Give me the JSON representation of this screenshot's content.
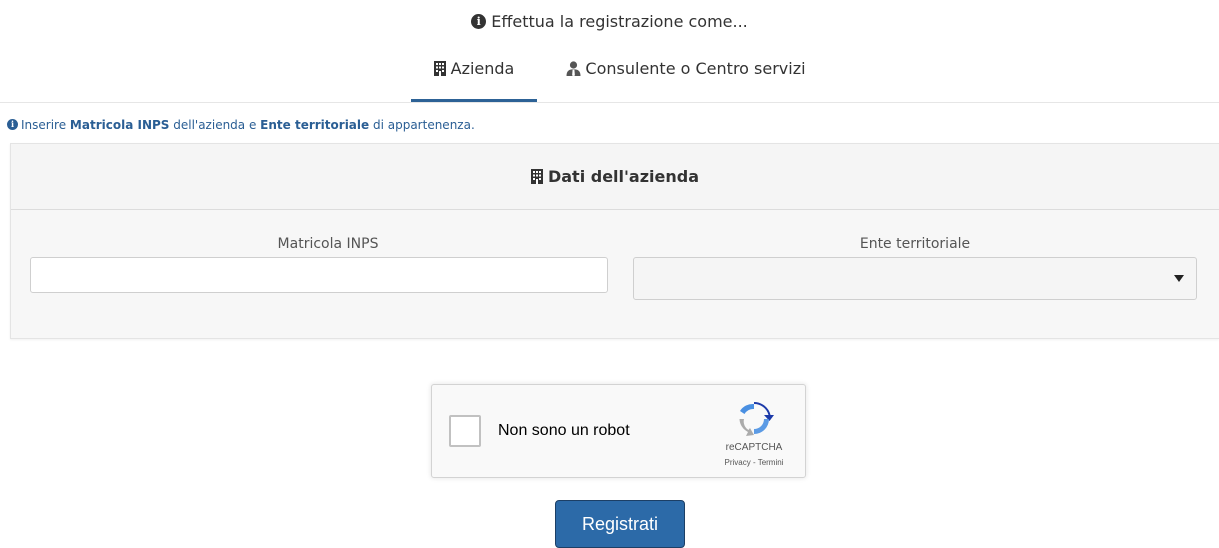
{
  "header": {
    "title": "Effettua la registrazione come..."
  },
  "tabs": [
    {
      "label": "Azienda",
      "icon": "building-icon",
      "active": true
    },
    {
      "label": "Consulente o Centro servizi",
      "icon": "user-tie-icon",
      "active": false
    }
  ],
  "hint": {
    "prefix": "Inserire ",
    "bold1": "Matricola INPS",
    "mid": " dell'azienda e ",
    "bold2": "Ente territoriale",
    "suffix": " di appartenenza."
  },
  "panel": {
    "title": "Dati dell'azienda",
    "matricola_label": "Matricola INPS",
    "matricola_value": "",
    "ente_label": "Ente territoriale",
    "ente_value": ""
  },
  "recaptcha": {
    "label": "Non sono un robot",
    "brand": "reCAPTCHA",
    "links": "Privacy - Termini"
  },
  "actions": {
    "register_label": "Registrati"
  },
  "colors": {
    "accent": "#2c6aa8",
    "hint_text": "#2a5e94",
    "tab_underline": "#2d6296"
  }
}
